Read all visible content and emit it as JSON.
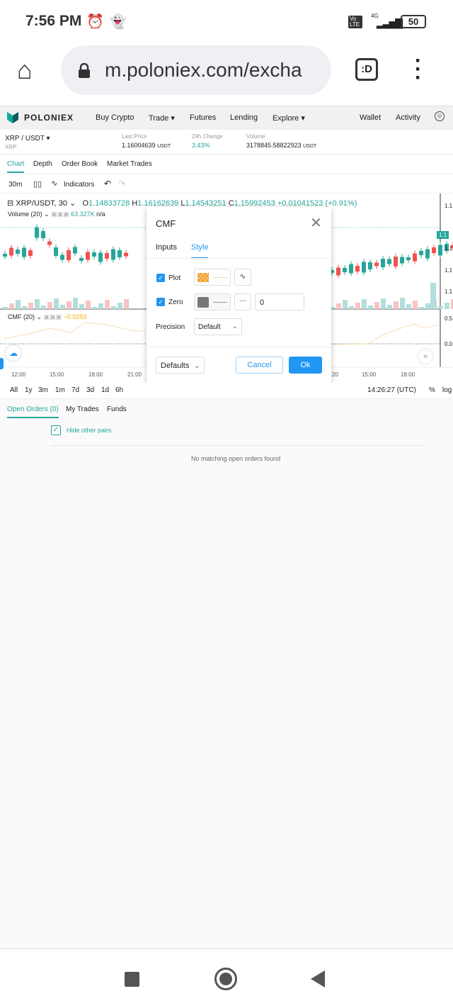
{
  "status_bar": {
    "time": "7:56 PM",
    "network": "4G",
    "volte": "Vo LTE",
    "battery": "50"
  },
  "browser": {
    "url": "m.poloniex.com/excha",
    "tab_label": ":D"
  },
  "nav": {
    "brand": "POLONIEX",
    "items": [
      "Buy Crypto",
      "Trade ▾",
      "Futures",
      "Lending",
      "Explore ▾"
    ],
    "wallet": "Wallet",
    "activity": "Activity"
  },
  "pair": {
    "name": "XRP / USDT ▾",
    "base": "XRP",
    "last_price_label": "Last Price",
    "last_price": "1.16004639",
    "last_price_unit": "USDT",
    "change_label": "24h Change",
    "change": "3.43%",
    "volume_label": "Volume",
    "volume": "3178845.58822923",
    "volume_unit": "USDT"
  },
  "tabs": [
    "Chart",
    "Depth",
    "Order Book",
    "Market Trades"
  ],
  "toolbar": {
    "interval": "30m",
    "indicators": "Indicators"
  },
  "chart": {
    "symbol": "XRP/USDT, 30 ⌄",
    "o_label": "O",
    "o": "1.14833728",
    "h_label": "H",
    "h": "1.16162639",
    "l_label": "L",
    "l": "1.14543251",
    "c_label": "C",
    "c": "1.15992453",
    "change": "+0.01041523 (+0.91%)",
    "volume_label": "Volume (20) ⌄",
    "volume_value": "63.327K",
    "volume_na": "n/a",
    "cmf_label": "CMF (20) ⌄",
    "cmf_value": "−0.0253",
    "x_ticks": [
      "12:00",
      "15:00",
      "18:00",
      "21:00",
      "20",
      "15:00",
      "18:00"
    ],
    "y_ticks": [
      "1.1",
      "1.1",
      "1.1",
      "1.1",
      "1.1"
    ],
    "price_tag": "1.1",
    "cmf_ticks": [
      "0.5",
      "0.0"
    ],
    "colors": {
      "up": "#26a69a",
      "down": "#ef5350"
    }
  },
  "dialog": {
    "title": "CMF",
    "tabs": [
      "Inputs",
      "Style"
    ],
    "active_tab": "Style",
    "plot_label": "Plot",
    "zero_label": "Zero",
    "zero_value": "0",
    "precision_label": "Precision",
    "precision_value": "Default",
    "defaults": "Defaults",
    "cancel": "Cancel",
    "ok": "Ok",
    "accent": "#2196f3"
  },
  "range": {
    "items": [
      "All",
      "1y",
      "3m",
      "1m",
      "7d",
      "3d",
      "1d",
      "6h"
    ],
    "time": "14:26:27 (UTC)",
    "percent": "%",
    "log": "log"
  },
  "orders": {
    "tabs": [
      "Open Orders (0)",
      "My Trades",
      "Funds"
    ],
    "hide_pairs": "Hide other pairs",
    "empty": "No matching open orders found"
  }
}
